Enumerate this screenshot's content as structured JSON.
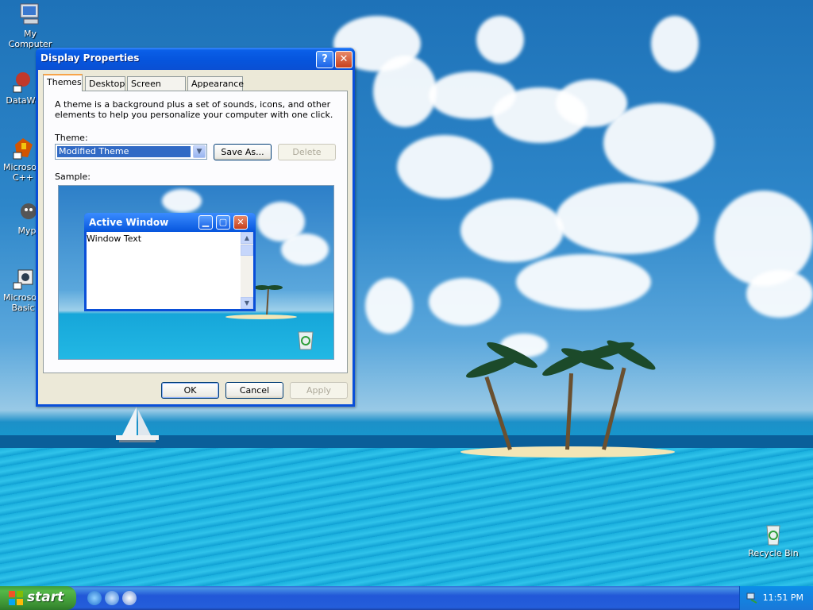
{
  "desktop": {
    "icons": [
      {
        "label": "My Computer"
      },
      {
        "label": "DataWa"
      },
      {
        "label": "Microsoft C++"
      },
      {
        "label": "Myp"
      },
      {
        "label": "Microsoft Basic"
      },
      {
        "label": "Recycle Bin"
      }
    ]
  },
  "dialog": {
    "title": "Display Properties",
    "help_glyph": "?",
    "close_glyph": "✕",
    "tabs": [
      {
        "label": "Themes",
        "active": true
      },
      {
        "label": "Desktop"
      },
      {
        "label": "Screen Saver"
      },
      {
        "label": "Appearance"
      }
    ],
    "description": "A theme is a background plus a set of sounds, icons, and other elements to help you personalize your computer with one click.",
    "theme_label": "Theme:",
    "theme_value": "Modified Theme",
    "save_as_label": "Save As...",
    "delete_label": "Delete",
    "sample_label": "Sample:",
    "sample_window": {
      "title": "Active Window",
      "text": "Window Text"
    },
    "ok_label": "OK",
    "cancel_label": "Cancel",
    "apply_label": "Apply"
  },
  "taskbar": {
    "start_label": "start",
    "clock": "11:51 PM"
  },
  "colors": {
    "title_blue": "#0a5fe8",
    "start_green": "#3a8f32",
    "selection": "#316ac5"
  }
}
